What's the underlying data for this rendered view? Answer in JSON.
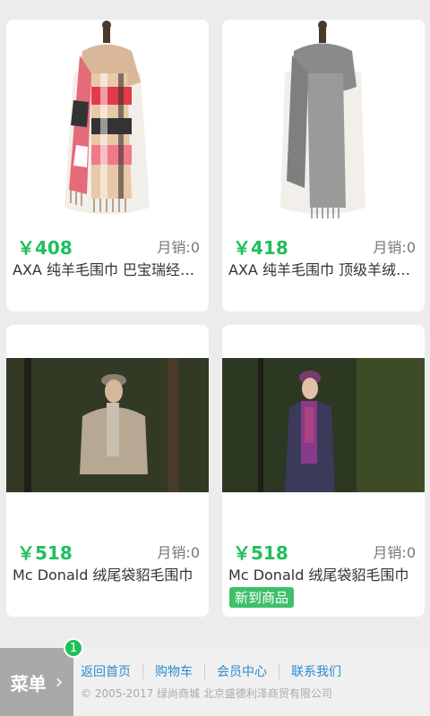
{
  "products": [
    {
      "price": "￥408",
      "sales": "月销:0",
      "title": "AXA 纯羊毛围巾 巴宝瑞经典格纹围巾",
      "badge": ""
    },
    {
      "price": "￥418",
      "sales": "月销:0",
      "title": "AXA 纯羊毛围巾 顶级羊绒灰色围巾",
      "badge": ""
    },
    {
      "price": "￥518",
      "sales": "月销:0",
      "title": "Mc Donald 绒尾袋貂毛围巾",
      "badge": ""
    },
    {
      "price": "￥518",
      "sales": "月销:0",
      "title": "Mc Donald 绒尾袋貂毛围巾",
      "badge": "新到商品"
    }
  ],
  "menu": {
    "label": "菜单",
    "badge_count": "1"
  },
  "footer": {
    "links": [
      "返回首页",
      "购物车",
      "会员中心",
      "联系我们"
    ],
    "copyright": "© 2005-2017 绿尚商城 北京盛德利泽商贸有限公司"
  },
  "colors": {
    "price": "#1fbf5a",
    "link": "#2a8ccf",
    "badge": "#3fbf6a"
  }
}
